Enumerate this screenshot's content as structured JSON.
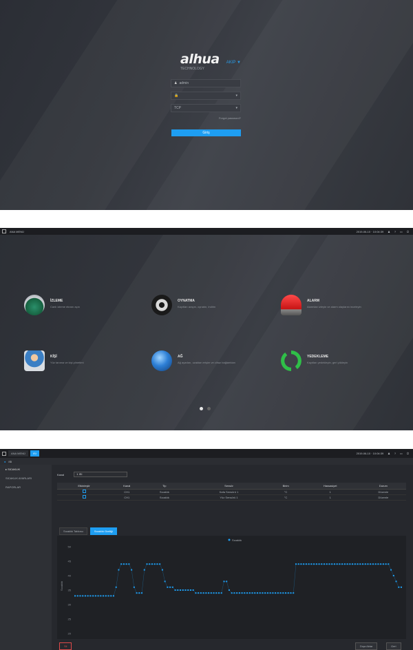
{
  "login": {
    "logo": "alhua",
    "logo_sub": "TECHNOLOGY",
    "language": "AKIP ▼",
    "username": "admin",
    "password": "",
    "channel": "TCP",
    "forgot": "Forgot password?",
    "login_button": "Giriş"
  },
  "menu": {
    "title": "ANA MENÜ",
    "status": "2019-06-10 · 10:04:39",
    "tiles": [
      {
        "title": "İZLEME",
        "desc": "Canlı izleme ekranı açın",
        "icon": "live-view-icon"
      },
      {
        "title": "OYNATMA",
        "desc": "Kayıtları arayın, oynatın, indirin",
        "icon": "playback-icon"
      },
      {
        "title": "ALARM",
        "desc": "Alarmları izleyin ve alarm olaylarını inceleyin",
        "icon": "alarm-icon"
      },
      {
        "title": "KİŞİ",
        "desc": "Yüz tanıma ve kişi yönetimi",
        "icon": "person-icon"
      },
      {
        "title": "AĞ",
        "desc": "Ağ ayarları, uzaktan erişim ve cihaz bağlantıları",
        "icon": "network-icon"
      },
      {
        "title": "YEDEKLEME",
        "desc": "Kayıtları yedekleyin, geri yükleyin",
        "icon": "backup-icon"
      }
    ]
  },
  "temp": {
    "tabs": [
      "ANA MENÜ",
      "ISI"
    ],
    "subbar": "ISI",
    "sidebar": [
      "▸ SICAKLIK",
      "SICAKLIK AYARLARI",
      "RAPORLAR"
    ],
    "select_label": "Kanal",
    "select_value": "1 ISI",
    "table_headers": [
      "Etkinleştir",
      "Kanal",
      "Tip",
      "Sensör",
      "Birim",
      "Hassasiyet",
      "Durum"
    ],
    "table_rows": [
      [
        "",
        "CH1",
        "Sıcaklık",
        "Kafa Sensörü 1",
        "°C",
        "1",
        "Düzenle"
      ],
      [
        "",
        "CH1",
        "Sıcaklık",
        "Yüz Sensörü 1",
        "°C",
        "1",
        "Düzenle"
      ]
    ],
    "subtabs": [
      "Sıcaklık Tablosu",
      "Sıcaklık Grafiği"
    ],
    "legend": "Sıcaklık",
    "buttons": {
      "delete": "Sil",
      "export": "Dışa Aktar",
      "back": "Geri"
    }
  },
  "chart_data": {
    "type": "scatter",
    "series": [
      {
        "name": "Sıcaklık",
        "values": [
          33,
          33,
          33,
          33,
          33,
          33,
          33,
          33,
          33,
          33,
          33,
          33,
          33,
          33,
          33,
          33,
          36,
          42,
          44,
          44,
          44,
          44,
          42,
          36,
          34,
          34,
          34,
          42,
          44,
          44,
          44,
          44,
          44,
          44,
          42,
          38,
          36,
          36,
          36,
          35,
          35,
          35,
          35,
          35,
          35,
          35,
          35,
          34,
          34,
          34,
          34,
          34,
          34,
          34,
          34,
          34,
          34,
          34,
          38,
          38,
          35,
          34,
          34,
          34,
          34,
          34,
          34,
          34,
          34,
          34,
          34,
          34,
          34,
          34,
          34,
          34,
          34,
          34,
          34,
          34,
          34,
          34,
          34,
          34,
          34,
          34,
          44,
          44,
          44,
          44,
          44,
          44,
          44,
          44,
          44,
          44,
          44,
          44,
          44,
          44,
          44,
          44,
          44,
          44,
          44,
          44,
          44,
          44,
          44,
          44,
          44,
          44,
          44,
          44,
          44,
          44,
          44,
          44,
          44,
          44,
          44,
          44,
          44,
          42,
          40,
          38,
          36,
          36
        ]
      }
    ],
    "ylim": [
      20,
      50
    ],
    "ylabel": "Sıcaklık",
    "yticks": [
      "50",
      "45",
      "40",
      "35",
      "30",
      "25",
      "20"
    ],
    "color": "#1e9ef2"
  }
}
